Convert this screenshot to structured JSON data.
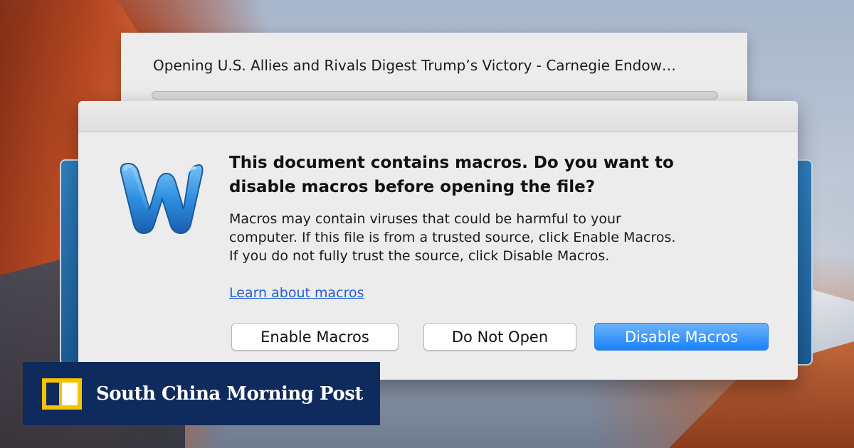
{
  "progress_sheet": {
    "title": "Opening U.S. Allies and Rivals Digest Trump’s Victory - Carnegie Endow…",
    "progress": 0
  },
  "dialog": {
    "heading_line1": "This document contains macros. Do you want to",
    "heading_line2": "disable macros before opening the file?",
    "body_line1": "Macros may contain viruses that could be harmful to your",
    "body_line2": "computer.  If this file is from a trusted source, click Enable Macros.",
    "body_line3": "If you do not fully trust the source, click Disable Macros.",
    "link_label": "Learn about macros",
    "buttons": {
      "enable": "Enable Macros",
      "do_not_open": "Do Not Open",
      "disable": "Disable Macros"
    },
    "app_icon": "microsoft-word-icon"
  },
  "branding": {
    "name": "South China Morning Post",
    "logo_icon": "scmp-logo-icon",
    "color": "#0f2a5c",
    "mark_color": "#f5c400"
  },
  "colors": {
    "primary_button": "#1a82fb",
    "link": "#1f5fd6"
  }
}
